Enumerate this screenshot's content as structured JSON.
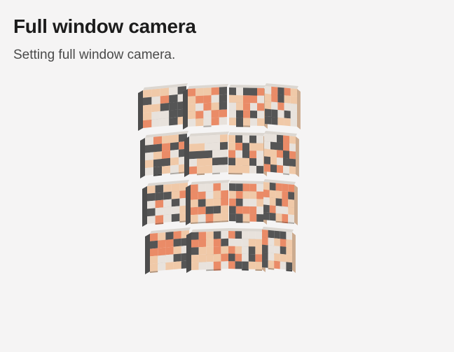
{
  "header": {
    "title": "Full window camera",
    "subtitle": "Setting full window camera."
  },
  "scene": {
    "grid_rows": 4,
    "grid_cols": 4,
    "palette": {
      "dark": "#555555",
      "orange": "#ea8b67",
      "peach": "#f0c9a8",
      "cream": "#e8e2dc",
      "background": "#f5f4f4"
    }
  }
}
